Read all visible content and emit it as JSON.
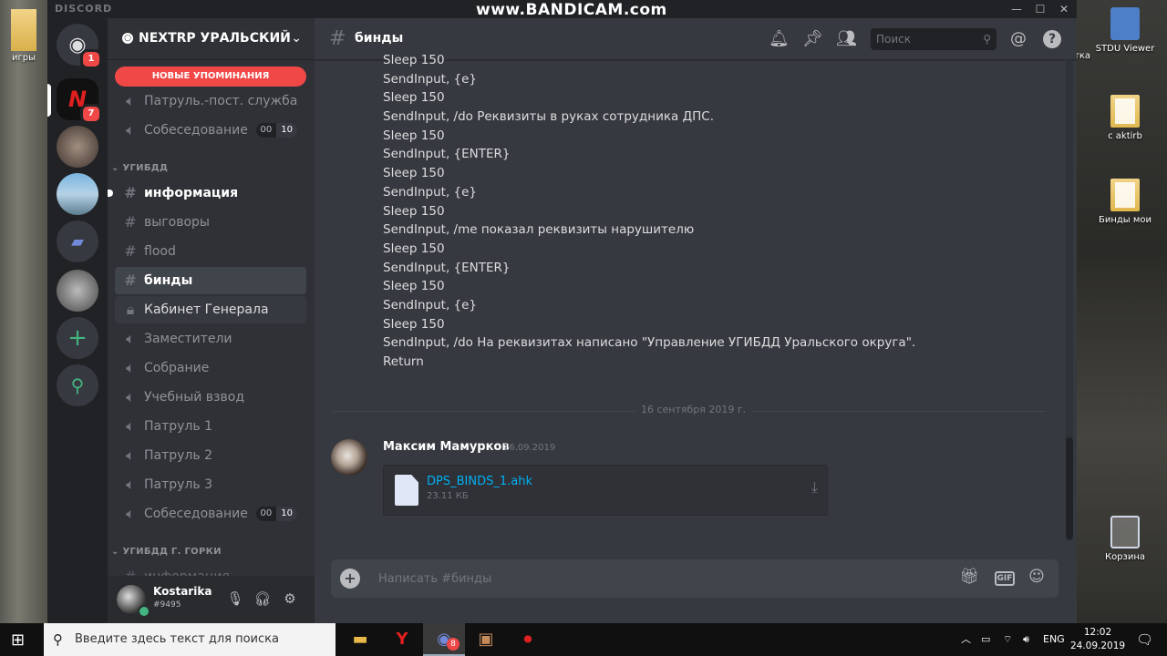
{
  "desktop": {
    "left_label": "игры",
    "icons": [
      {
        "label": "STDU Viewer",
        "prefix": "тка"
      },
      {
        "label": "с aktirb",
        "prefix": ""
      },
      {
        "label": "Бинды мои",
        "prefix": ""
      },
      {
        "label": "Корзина",
        "prefix": ""
      }
    ]
  },
  "window": {
    "brand": "DISCORD",
    "watermark": "www.BANDICAM.com",
    "controls": {
      "minimize": "—",
      "maximize": "☐",
      "close": "✕"
    }
  },
  "guilds": [
    {
      "name": "discord-home",
      "glyph": "◉",
      "badge": "1",
      "color": "#36393f"
    },
    {
      "name": "nextrp",
      "glyph": "N",
      "badge": "7",
      "color": "#111"
    },
    {
      "name": "server-dog",
      "glyph": "",
      "badge": "",
      "color": "#6e5f57"
    },
    {
      "name": "server-sky",
      "glyph": "",
      "badge": "",
      "color": "#6fa3c9"
    },
    {
      "name": "folder",
      "glyph": "▰",
      "badge": "",
      "color": "#36393f"
    },
    {
      "name": "server-group",
      "glyph": "",
      "badge": "",
      "color": "#8c8c8c"
    },
    {
      "name": "add-server",
      "glyph": "+",
      "badge": "",
      "color": "#36393f"
    },
    {
      "name": "explore",
      "glyph": "⚲",
      "badge": "",
      "color": "#36393f"
    }
  ],
  "server": {
    "name": "NEXTRP УРАЛЬСКИЙ",
    "mention_pill": "НОВЫЕ УПОМИНАНИЯ"
  },
  "channels_top": [
    {
      "label": "Патруль.-пост. служба",
      "icon": "voice"
    },
    {
      "label": "Собеседование",
      "icon": "voice",
      "counts": [
        "00",
        "10"
      ]
    }
  ],
  "category_1": "УГИБДД",
  "channels_ugibdd": [
    {
      "label": "информация",
      "icon": "text",
      "state": "unread"
    },
    {
      "label": "выговоры",
      "icon": "text",
      "state": ""
    },
    {
      "label": "flood",
      "icon": "text",
      "state": ""
    },
    {
      "label": "бинды",
      "icon": "text",
      "state": "selected"
    },
    {
      "label": "Кабинет Генерала",
      "icon": "lock",
      "state": "hover"
    },
    {
      "label": "Заместители",
      "icon": "voice",
      "state": ""
    },
    {
      "label": "Собрание",
      "icon": "voice",
      "state": ""
    },
    {
      "label": "Учебный взвод",
      "icon": "voice",
      "state": ""
    },
    {
      "label": "Патруль 1",
      "icon": "voice",
      "state": ""
    },
    {
      "label": "Патруль 2",
      "icon": "voice",
      "state": ""
    },
    {
      "label": "Патруль 3",
      "icon": "voice",
      "state": ""
    },
    {
      "label": "Собеседование",
      "icon": "voice",
      "state": "",
      "counts": [
        "00",
        "10"
      ]
    }
  ],
  "category_2": "УГИБДД Г. ГОРКИ",
  "channels_gorki": [
    {
      "label": "информация",
      "icon": "text"
    }
  ],
  "user": {
    "name": "Kostarika",
    "tag": "#9495"
  },
  "chat": {
    "channel": "бинды",
    "search_placeholder": "Поиск",
    "lines": [
      "Sleep 150",
      "SendInput, {e}",
      "Sleep 150",
      "SendInput, /do Реквизиты в руках сотрудника ДПС.",
      "Sleep 150",
      "SendInput, {ENTER}",
      "Sleep 150",
      "SendInput, {e}",
      "Sleep 150",
      "SendInput, /me показал реквизиты нарушителю",
      "Sleep 150",
      "SendInput, {ENTER}",
      "Sleep 150",
      "SendInput, {e}",
      "Sleep 150",
      "SendInput, /do На реквизитах написано \"Управление УГИБДД Уральского округа\".",
      "Return"
    ],
    "date_divider": "16 сентября 2019 г.",
    "message": {
      "author": "Максим Мамурков",
      "time": "16.09.2019",
      "file_name": "DPS_BINDS_1.ahk",
      "file_size": "23.11 КБ"
    },
    "composer_placeholder": "Написать #бинды"
  },
  "taskbar": {
    "search_placeholder": "Введите здесь текст для поиска",
    "discord_badge": "8",
    "language": "ENG",
    "time": "12:02",
    "date": "24.09.2019"
  }
}
